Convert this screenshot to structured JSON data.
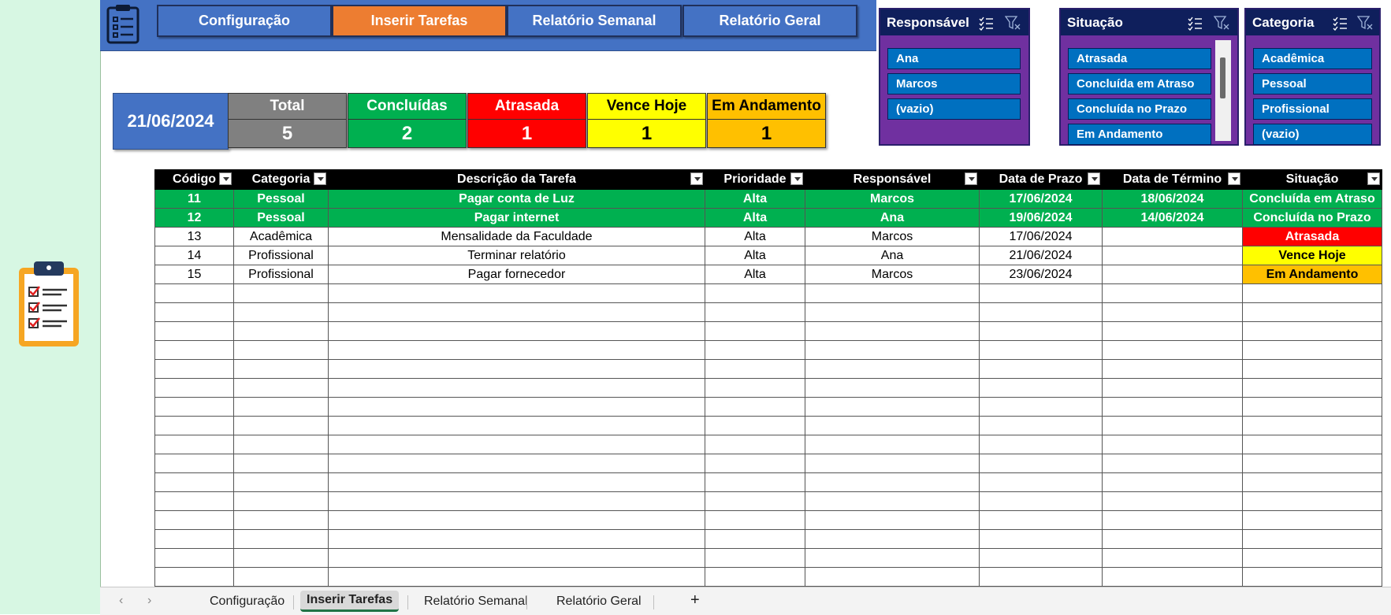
{
  "nav": {
    "buttons": [
      "Configuração",
      "Inserir Tarefas",
      "Relatório Semanal",
      "Relatório Geral"
    ]
  },
  "summary": {
    "date": "21/06/2024",
    "kpis": [
      {
        "label": "Total",
        "value": "5",
        "color": "#808080",
        "text_color": "#ffffff"
      },
      {
        "label": "Concluídas",
        "value": "2",
        "color": "#00b050",
        "text_color": "#ffffff"
      },
      {
        "label": "Atrasada",
        "value": "1",
        "color": "#ff0000",
        "text_color": "#ffffff"
      },
      {
        "label": "Vence Hoje",
        "value": "1",
        "color": "#ffff00",
        "text_color": "#000000"
      },
      {
        "label": "Em Andamento",
        "value": "1",
        "color": "#ffc000",
        "text_color": "#000000"
      }
    ]
  },
  "slicers": [
    {
      "title": "Responsável",
      "items": [
        "Ana",
        "Marcos",
        "(vazio)"
      ]
    },
    {
      "title": "Situação",
      "items": [
        "Atrasada",
        "Concluída em Atraso",
        "Concluída no Prazo",
        "Em Andamento"
      ]
    },
    {
      "title": "Categoria",
      "items": [
        "Acadêmica",
        "Pessoal",
        "Profissional",
        "(vazio)"
      ]
    }
  ],
  "table": {
    "headers": [
      "Código",
      "Categoria",
      "Descrição da Tarefa",
      "Prioridade",
      "Responsável",
      "Data de Prazo",
      "Data de Término",
      "Situação"
    ],
    "rows": [
      [
        "11",
        "Pessoal",
        "Pagar conta de Luz",
        "Alta",
        "Marcos",
        "17/06/2024",
        "18/06/2024",
        "Concluída em Atraso"
      ],
      [
        "12",
        "Pessoal",
        "Pagar internet",
        "Alta",
        "Ana",
        "19/06/2024",
        "14/06/2024",
        "Concluída no Prazo"
      ],
      [
        "13",
        "Acadêmica",
        "Mensalidade da Faculdade",
        "Alta",
        "Marcos",
        "17/06/2024",
        "",
        "Atrasada"
      ],
      [
        "14",
        "Profissional",
        "Terminar relatório",
        "Alta",
        "Ana",
        "21/06/2024",
        "",
        "Vence Hoje"
      ],
      [
        "15",
        "Profissional",
        "Pagar fornecedor",
        "Alta",
        "Marcos",
        "23/06/2024",
        "",
        "Em Andamento"
      ]
    ]
  },
  "sheet_tabs": [
    "Configuração",
    "Inserir Tarefas",
    "Relatório Semanal",
    "Relatório Geral"
  ],
  "add_sheet_label": "+",
  "colors": {
    "accent_blue": "#4472c4",
    "active_orange": "#ed7d31",
    "slicer_purple": "#7030a0",
    "slicer_item": "#0070c0",
    "done_green": "#00b050"
  }
}
